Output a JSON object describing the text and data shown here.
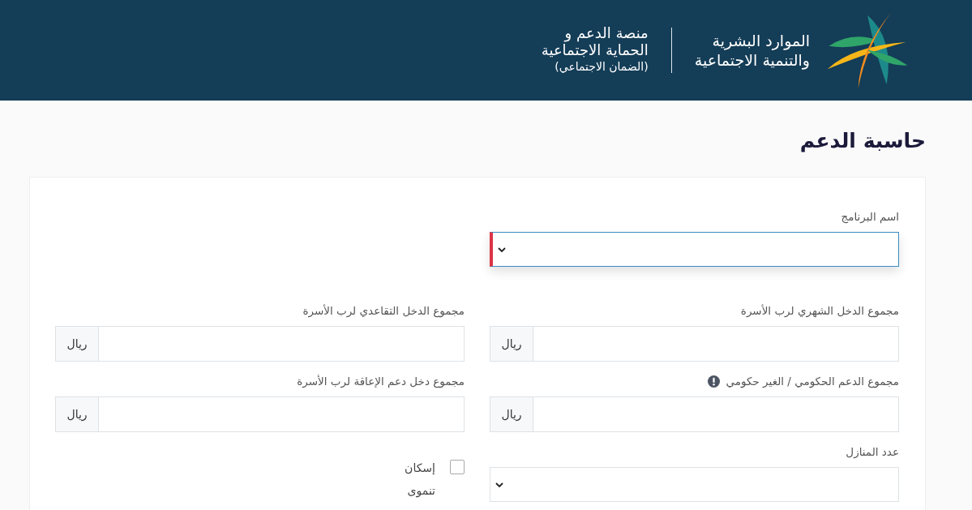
{
  "header": {
    "logo_lines": [
      "الموارد البشرية",
      "والتنمية الاجتماعية"
    ],
    "platform_lines": [
      "منصة الدعم و",
      "الحماية الاجتماعية",
      "(الضمان الاجتماعي)"
    ]
  },
  "page_title": "حاسبة الدعم",
  "rows": [
    [
      {
        "kind": "select",
        "label": "اسم البرنامج",
        "invalid": true,
        "focused": true
      }
    ],
    [
      {
        "kind": "currency",
        "label": "مجموع الدخل الشهري لرب الأسرة",
        "unit": "ريال",
        "info": false
      },
      {
        "kind": "currency",
        "label": "مجموع الدخل التقاعدي لرب الأسرة",
        "unit": "ريال",
        "info": false
      }
    ],
    [
      {
        "kind": "currency",
        "label": "مجموع الدعم الحكومي / الغير حكومي",
        "unit": "ريال",
        "info": true
      },
      {
        "kind": "currency",
        "label": "مجموع دخل دعم الإعاقة لرب الأسرة",
        "unit": "ريال",
        "info": false
      }
    ],
    [
      {
        "kind": "select",
        "label": "عدد المنازل",
        "invalid": false,
        "focused": false
      },
      {
        "kind": "checkbox",
        "label": "إسكان تنموى",
        "checked": false
      }
    ]
  ]
}
